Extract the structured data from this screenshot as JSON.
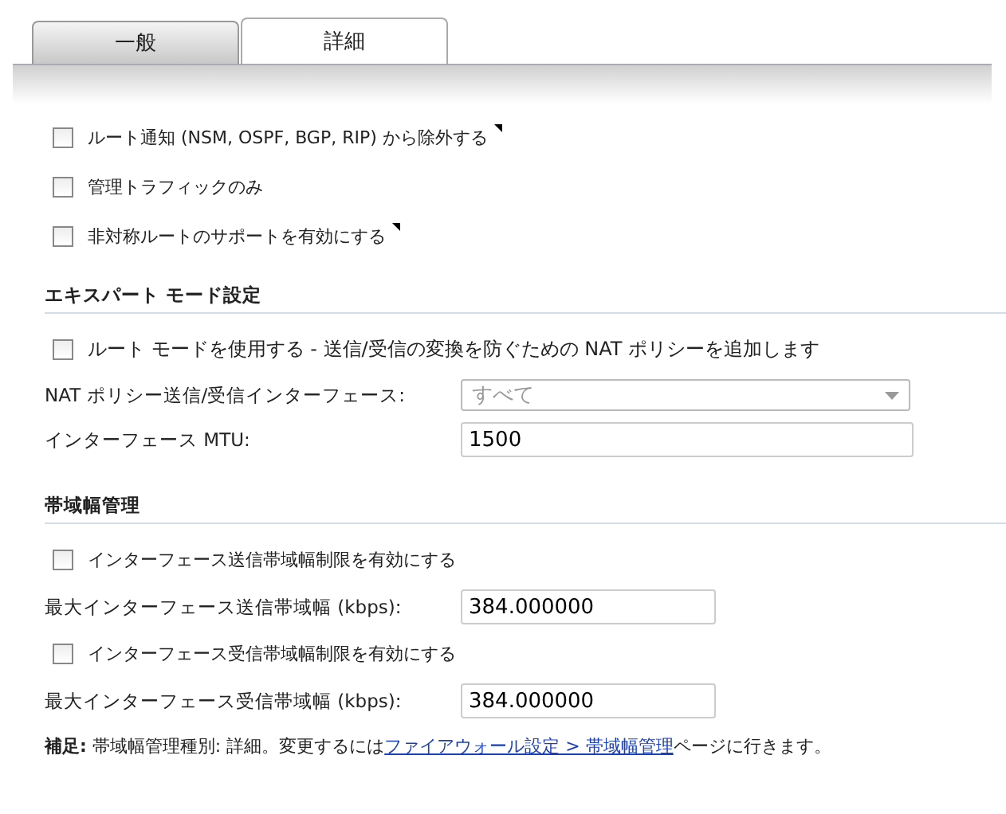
{
  "tabs": [
    {
      "label": "一般",
      "selected": false
    },
    {
      "label": "詳細",
      "selected": true
    }
  ],
  "sections": [
    {
      "items": [
        {
          "kind": "checkbox",
          "label": "ルート通知 (NSM, OSPF, BGP, RIP) から除外する",
          "checked": false,
          "marker": true
        },
        {
          "kind": "checkbox",
          "label": "管理トラフィックのみ",
          "checked": false,
          "marker": false
        },
        {
          "kind": "checkbox",
          "label": "非対称ルートのサポートを有効にする",
          "checked": false,
          "marker": true
        }
      ]
    },
    {
      "heading": "エキスパート モード設定",
      "items": [
        {
          "kind": "checkbox",
          "label": "ルート モードを使用する - 送信/受信の変換を防ぐための NAT ポリシーを追加します",
          "checked": false,
          "marker": false
        },
        {
          "kind": "select",
          "label": "NAT ポリシー送信/受信インターフェース:",
          "value": "すべて",
          "disabled": true
        },
        {
          "kind": "text",
          "label": "インターフェース MTU:",
          "value": "1500"
        }
      ]
    },
    {
      "heading": "帯域幅管理",
      "items": [
        {
          "kind": "checkbox",
          "label": "インターフェース送信帯域幅制限を有効にする",
          "checked": false,
          "marker": false
        },
        {
          "kind": "text",
          "label": "最大インターフェース送信帯域幅 (kbps):",
          "value": "384.000000"
        },
        {
          "kind": "checkbox",
          "label": "インターフェース受信帯域幅制限を有効にする",
          "checked": false,
          "marker": false
        },
        {
          "kind": "text",
          "label": "最大インターフェース受信帯域幅 (kbps):",
          "value": "384.000000"
        }
      ]
    }
  ],
  "note": {
    "text": "**補足:** 帯域幅管理種別: 詳細。変更するには",
    "link": "ファイアウォール設定 > 帯域幅管理",
    "suffix": "ページに行きます。"
  }
}
